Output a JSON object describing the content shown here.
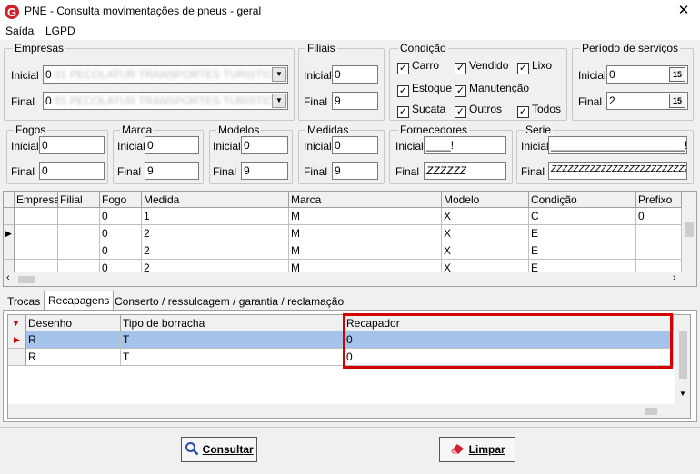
{
  "window": {
    "title": "PNE - Consulta movimentações de pneus - geral",
    "close_glyph": "✕"
  },
  "menu": {
    "items": [
      "Saída",
      "LGPD"
    ]
  },
  "groups": {
    "empresas": {
      "title": "Empresas",
      "inicial_label": "Inicial",
      "final_label": "Final",
      "inicial_value": "0",
      "final_value": "0",
      "inicial_blur": "01 PECOLATUR TRANSPORTES TURISTICOS",
      "final_blur": "01 PECOLATUR TRANSPORTES TURISTICOS"
    },
    "filiais": {
      "title": "Filiais",
      "inicial_label": "Inicial",
      "final_label": "Final",
      "inicial_value": "0",
      "final_value": "9"
    },
    "condicao": {
      "title": "Condição",
      "options": [
        "Carro",
        "Vendido",
        "Lixo",
        "Estoque",
        "Manutenção",
        "Sucata",
        "Outros",
        "Todos"
      ]
    },
    "periodo": {
      "title": "Período de serviços",
      "inicial_label": "Inicial",
      "final_label": "Final",
      "inicial_value": "0",
      "final_value": "2"
    },
    "fogos": {
      "title": "Fogos",
      "inicial_label": "Inicial",
      "final_label": "Final",
      "inicial_value": "0",
      "final_value": "0"
    },
    "marca": {
      "title": "Marca",
      "inicial_label": "Inicial",
      "final_label": "Final",
      "inicial_value": "0",
      "final_value": "9"
    },
    "modelos": {
      "title": "Modelos",
      "inicial_label": "Inicial",
      "final_label": "Final",
      "inicial_value": "0",
      "final_value": "9"
    },
    "medidas": {
      "title": "Medidas",
      "inicial_label": "Inicial",
      "final_label": "Final",
      "inicial_value": "0",
      "final_value": "9"
    },
    "fornecedores": {
      "title": "Fornecedores",
      "inicial_label": "Inicial",
      "final_label": "Final",
      "inicial_value": "____!",
      "final_value": "ZZZZZZ"
    },
    "serie": {
      "title": "Serie",
      "inicial_label": "Inicial",
      "final_label": "Final",
      "inicial_value": "______________________!",
      "final_value": "ZZZZZZZZZZZZZZZZZZZZZZZZZZZ"
    }
  },
  "main_grid": {
    "columns": [
      "Empresa",
      "Filial",
      "Fogo",
      "Medida",
      "Marca",
      "Modelo",
      "Condição",
      "Prefixo"
    ],
    "rows": [
      {
        "fogo": "0",
        "medida": "1",
        "marca": "M",
        "modelo": "X",
        "condicao": "C",
        "prefixo": "0"
      },
      {
        "fogo": "0",
        "medida": "2",
        "marca": "M",
        "modelo": "X",
        "condicao": "E",
        "prefixo": ""
      },
      {
        "fogo": "0",
        "medida": "2",
        "marca": "M",
        "modelo": "X",
        "condicao": "E",
        "prefixo": ""
      },
      {
        "fogo": "0",
        "medida": "2",
        "marca": "M",
        "modelo": "X",
        "condicao": "E",
        "prefixo": ""
      }
    ]
  },
  "tabs": [
    "Trocas",
    "Recapagens",
    "Conserto / ressulcagem / garantia / reclamação"
  ],
  "recap_grid": {
    "columns": [
      "Desenho",
      "Tipo de borracha",
      "Recapador"
    ],
    "rows": [
      {
        "desenho": "R",
        "tipo": "T",
        "recapador": "0"
      },
      {
        "desenho": "R",
        "tipo": "T",
        "recapador": "0"
      }
    ]
  },
  "buttons": {
    "consultar": "Consultar",
    "limpar": "Limpar"
  },
  "colors": {
    "accent": "#cc0000",
    "selected_row": "#a4c3ea",
    "highlight_border": "#d40000"
  },
  "icons": {
    "app": "g-logo-icon",
    "consultar": "search-icon",
    "limpar": "eraser-icon"
  }
}
